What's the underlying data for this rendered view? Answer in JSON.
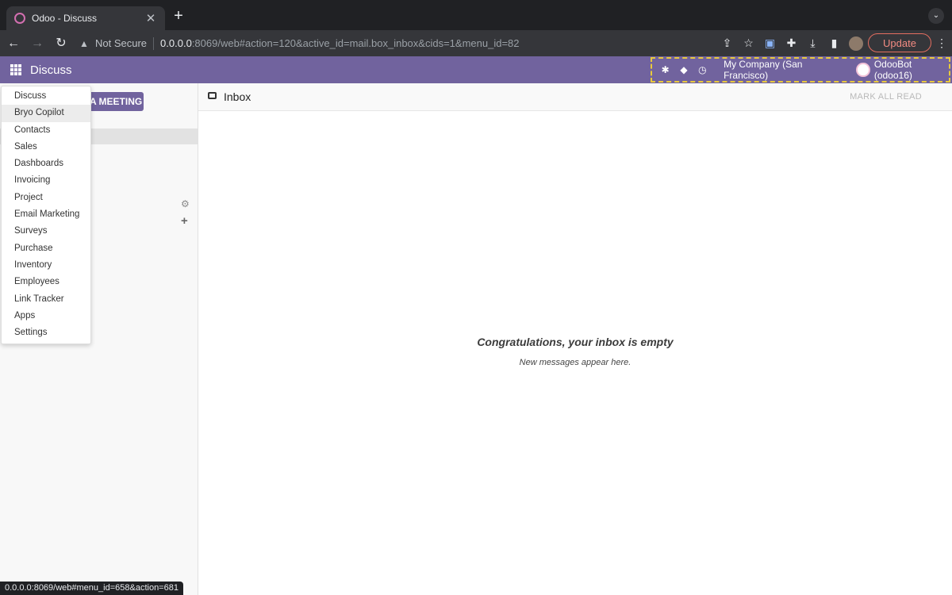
{
  "browser": {
    "tab_title": "Odoo - Discuss",
    "tab_close": "✕",
    "new_tab": "+",
    "security_label": "Not Secure",
    "url_host": "0.0.0.0",
    "url_rest": ":8069/web#action=120&active_id=mail.box_inbox&cids=1&menu_id=82",
    "update_label": "Update",
    "status_url": "0.0.0.0:8069/web#menu_id=658&action=681"
  },
  "navbar": {
    "app_title": "Discuss",
    "company": "My Company (San Francisco)",
    "user": "OdooBot (odoo16)"
  },
  "sidebar": {
    "start_meeting_label": "A MEETING"
  },
  "main": {
    "header_title": "Inbox",
    "mark_all_read": "MARK ALL READ",
    "empty_title": "Congratulations, your inbox is empty",
    "empty_subtitle": "New messages appear here."
  },
  "app_menu": {
    "items": [
      "Discuss",
      "Bryo Copilot",
      "Contacts",
      "Sales",
      "Dashboards",
      "Invoicing",
      "Project",
      "Email Marketing",
      "Surveys",
      "Purchase",
      "Inventory",
      "Employees",
      "Link Tracker",
      "Apps",
      "Settings"
    ],
    "highlighted": "Bryo Copilot"
  },
  "colors": {
    "brand": "#71639e",
    "systray_outline": "#e8c93c"
  }
}
